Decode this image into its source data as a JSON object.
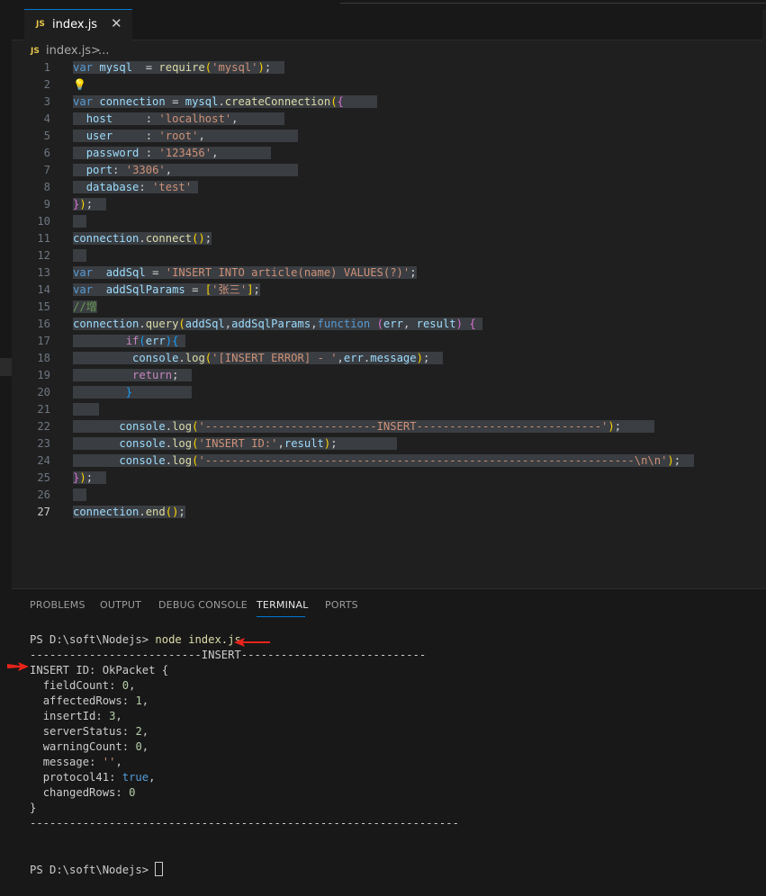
{
  "tab": {
    "badge": "JS",
    "name": "index.js",
    "close": "✕"
  },
  "breadcrumb": {
    "badge": "JS",
    "file": "index.js",
    "sep": ">",
    "more": "..."
  },
  "editor": {
    "lines": [
      {
        "n": "1",
        "tokens": [
          [
            "kw",
            "var"
          ],
          [
            "pl",
            " "
          ],
          [
            "id",
            "mysql"
          ],
          [
            "pl",
            "  = "
          ],
          [
            "fn",
            "require"
          ],
          [
            "br1",
            "("
          ],
          [
            "str",
            "'mysql'"
          ],
          [
            "br1",
            ")"
          ],
          [
            "pl",
            ";  "
          ]
        ]
      },
      {
        "n": "2",
        "tokens": [],
        "bulb": true
      },
      {
        "n": "3",
        "tokens": [
          [
            "kw",
            "var"
          ],
          [
            "pl",
            " "
          ],
          [
            "id",
            "connection"
          ],
          [
            "pl",
            " = "
          ],
          [
            "id",
            "mysql"
          ],
          [
            "pl",
            "."
          ],
          [
            "fn",
            "createConnection"
          ],
          [
            "br1",
            "("
          ],
          [
            "br2",
            "{"
          ],
          [
            "pl",
            "     "
          ]
        ]
      },
      {
        "n": "4",
        "tokens": [
          [
            "pl",
            "  "
          ],
          [
            "id",
            "host"
          ],
          [
            "pl",
            "     : "
          ],
          [
            "str",
            "'localhost'"
          ],
          [
            "pl",
            ",       "
          ]
        ]
      },
      {
        "n": "5",
        "tokens": [
          [
            "pl",
            "  "
          ],
          [
            "id",
            "user"
          ],
          [
            "pl",
            "     : "
          ],
          [
            "str",
            "'root'"
          ],
          [
            "pl",
            ",              "
          ]
        ]
      },
      {
        "n": "6",
        "tokens": [
          [
            "pl",
            "  "
          ],
          [
            "id",
            "password"
          ],
          [
            "pl",
            " : "
          ],
          [
            "str",
            "'123456'"
          ],
          [
            "pl",
            ",        "
          ]
        ]
      },
      {
        "n": "7",
        "tokens": [
          [
            "pl",
            "  "
          ],
          [
            "id",
            "port"
          ],
          [
            "pl",
            ": "
          ],
          [
            "str",
            "'3306'"
          ],
          [
            "pl",
            ",                   "
          ]
        ]
      },
      {
        "n": "8",
        "tokens": [
          [
            "pl",
            "  "
          ],
          [
            "id",
            "database"
          ],
          [
            "pl",
            ": "
          ],
          [
            "str",
            "'test'"
          ],
          [
            "pl",
            " "
          ]
        ]
      },
      {
        "n": "9",
        "tokens": [
          [
            "br2",
            "}"
          ],
          [
            "br1",
            ")"
          ],
          [
            "pl",
            ";  "
          ]
        ]
      },
      {
        "n": "10",
        "tokens": [
          [
            "pl",
            "  "
          ]
        ]
      },
      {
        "n": "11",
        "tokens": [
          [
            "id",
            "connection"
          ],
          [
            "pl",
            "."
          ],
          [
            "fn",
            "connect"
          ],
          [
            "br1",
            "()"
          ],
          [
            "pl",
            ";"
          ]
        ]
      },
      {
        "n": "12",
        "tokens": [
          [
            "pl",
            "  "
          ]
        ]
      },
      {
        "n": "13",
        "tokens": [
          [
            "kw",
            "var"
          ],
          [
            "pl",
            "  "
          ],
          [
            "id",
            "addSql"
          ],
          [
            "pl",
            " = "
          ],
          [
            "str",
            "'INSERT INTO article(name) VALUES(?)'"
          ],
          [
            "pl",
            ";"
          ]
        ]
      },
      {
        "n": "14",
        "tokens": [
          [
            "kw",
            "var"
          ],
          [
            "pl",
            "  "
          ],
          [
            "id",
            "addSqlParams"
          ],
          [
            "pl",
            " = "
          ],
          [
            "br1",
            "["
          ],
          [
            "str",
            "'张三'"
          ],
          [
            "br1",
            "]"
          ],
          [
            "pl",
            ";"
          ]
        ]
      },
      {
        "n": "15",
        "tokens": [
          [
            "cmt",
            "//增"
          ]
        ]
      },
      {
        "n": "16",
        "tokens": [
          [
            "id",
            "connection"
          ],
          [
            "pl",
            "."
          ],
          [
            "fn",
            "query"
          ],
          [
            "br1",
            "("
          ],
          [
            "id",
            "addSql"
          ],
          [
            "pl",
            ","
          ],
          [
            "id",
            "addSqlParams"
          ],
          [
            "pl",
            ","
          ],
          [
            "kw",
            "function"
          ],
          [
            "pl",
            " "
          ],
          [
            "br2",
            "("
          ],
          [
            "id",
            "err"
          ],
          [
            "pl",
            ", "
          ],
          [
            "id",
            "result"
          ],
          [
            "br2",
            ")"
          ],
          [
            "pl",
            " "
          ],
          [
            "br2",
            "{"
          ],
          [
            "pl",
            " "
          ]
        ]
      },
      {
        "n": "17",
        "tokens": [
          [
            "pl",
            "        "
          ],
          [
            "kw2",
            "if"
          ],
          [
            "br3",
            "("
          ],
          [
            "id",
            "err"
          ],
          [
            "br3",
            "){"
          ],
          [
            "pl",
            " "
          ]
        ]
      },
      {
        "n": "18",
        "tokens": [
          [
            "pl",
            "         "
          ],
          [
            "id",
            "console"
          ],
          [
            "pl",
            "."
          ],
          [
            "fn",
            "log"
          ],
          [
            "br1",
            "("
          ],
          [
            "str",
            "'[INSERT ERROR] - '"
          ],
          [
            "pl",
            ","
          ],
          [
            "id",
            "err"
          ],
          [
            "pl",
            "."
          ],
          [
            "id",
            "message"
          ],
          [
            "br1",
            ")"
          ],
          [
            "pl",
            ";  "
          ]
        ]
      },
      {
        "n": "19",
        "tokens": [
          [
            "pl",
            "         "
          ],
          [
            "kw2",
            "return"
          ],
          [
            "pl",
            ";  "
          ]
        ]
      },
      {
        "n": "20",
        "tokens": [
          [
            "pl",
            "        "
          ],
          [
            "br3",
            "}"
          ],
          [
            "pl",
            "         "
          ]
        ]
      },
      {
        "n": "21",
        "tokens": [
          [
            "pl",
            "    "
          ]
        ]
      },
      {
        "n": "22",
        "tokens": [
          [
            "pl",
            "       "
          ],
          [
            "id",
            "console"
          ],
          [
            "pl",
            "."
          ],
          [
            "fn",
            "log"
          ],
          [
            "br1",
            "("
          ],
          [
            "str",
            "'--------------------------INSERT----------------------------'"
          ],
          [
            "br1",
            ")"
          ],
          [
            "pl",
            ";     "
          ]
        ]
      },
      {
        "n": "23",
        "tokens": [
          [
            "pl",
            "       "
          ],
          [
            "id",
            "console"
          ],
          [
            "pl",
            "."
          ],
          [
            "fn",
            "log"
          ],
          [
            "br1",
            "("
          ],
          [
            "str",
            "'INSERT ID:'"
          ],
          [
            "pl",
            ","
          ],
          [
            "id",
            "result"
          ],
          [
            "br1",
            ")"
          ],
          [
            "pl",
            ";         "
          ]
        ]
      },
      {
        "n": "24",
        "tokens": [
          [
            "pl",
            "       "
          ],
          [
            "id",
            "console"
          ],
          [
            "pl",
            "."
          ],
          [
            "fn",
            "log"
          ],
          [
            "br1",
            "("
          ],
          [
            "str",
            "'-----------------------------------------------------------------\\n\\n'"
          ],
          [
            "br1",
            ")"
          ],
          [
            "pl",
            ";  "
          ]
        ]
      },
      {
        "n": "25",
        "tokens": [
          [
            "br2",
            "}"
          ],
          [
            "br1",
            ")"
          ],
          [
            "pl",
            ";  "
          ]
        ]
      },
      {
        "n": "26",
        "tokens": [
          [
            "pl",
            "  "
          ]
        ]
      },
      {
        "n": "27",
        "tokens": [
          [
            "id",
            "connection"
          ],
          [
            "pl",
            "."
          ],
          [
            "fn",
            "end"
          ],
          [
            "br1",
            "()"
          ],
          [
            "pl",
            ";"
          ]
        ],
        "current": true
      }
    ]
  },
  "panel": {
    "tabs": [
      "PROBLEMS",
      "OUTPUT",
      "DEBUG CONSOLE",
      "TERMINAL",
      "PORTS"
    ],
    "active_tab": "TERMINAL"
  },
  "terminal": {
    "prompt1": "PS D:\\soft\\Nodejs> ",
    "cmd": "node index.js",
    "insert_line": "--------------------------INSERT----------------------------",
    "result_head": "INSERT ID: OkPacket {",
    "fields": [
      {
        "k": "fieldCount",
        "v": "0",
        "t": "num"
      },
      {
        "k": "affectedRows",
        "v": "1",
        "t": "num"
      },
      {
        "k": "insertId",
        "v": "3",
        "t": "num"
      },
      {
        "k": "serverStatus",
        "v": "2",
        "t": "num"
      },
      {
        "k": "warningCount",
        "v": "0",
        "t": "num"
      },
      {
        "k": "message",
        "v": "''",
        "t": "str"
      },
      {
        "k": "protocol41",
        "v": "true",
        "t": "bool"
      },
      {
        "k": "changedRows",
        "v": "0",
        "t": "num",
        "last": true
      }
    ],
    "close_brace": "}",
    "end_line": "-----------------------------------------------------------------",
    "prompt2": "PS D:\\soft\\Nodejs> "
  },
  "colors": {
    "accent": "#0078d4",
    "arrow": "#e8231a"
  }
}
